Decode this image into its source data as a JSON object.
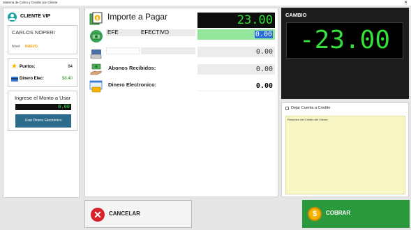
{
  "window": {
    "title": "Sistema de Cobro y Credito por Cliente",
    "close_glyph": "✕"
  },
  "customer": {
    "section_title": "CLIENTE VIP",
    "name": "CARLOS NOPERI",
    "level_label": "Nivel:",
    "level_value": "NUEVO",
    "points_label": "Puntos:",
    "points_value": "84",
    "wallet_label": "Dinero Elec:",
    "wallet_value": "$8.40"
  },
  "wallet_use": {
    "title": "Ingrese el Monto a Usar",
    "amount": "0.00",
    "button_label": "Usar Dinero Electrónico"
  },
  "payment": {
    "total_label": "Importe a Pagar",
    "total_amount": "23.00",
    "method_code": "EFE",
    "method_name": "EFECTIVO",
    "method_amount": "0.00",
    "second_amount": "0.00",
    "abonos_label": "Abonos Recibidos:",
    "abonos_amount": "0.00",
    "electronic_label": "Dinero Electronico:",
    "electronic_amount": "0.00"
  },
  "change": {
    "label": "CAMBIO",
    "amount": "-23.00"
  },
  "credit": {
    "checkbox_label": "Dejar Cuenta a Credito",
    "summary_label": "Resumen del Crédito del Cliente"
  },
  "actions": {
    "cancel_label": "CANCELAR",
    "charge_label": "COBRAR"
  },
  "colors": {
    "accent_green": "#2b9a3c",
    "display_green": "#33e033",
    "cancel_red": "#d6222a",
    "vip_teal": "#1aa3a3"
  },
  "icons": [
    "user-icon",
    "star-icon",
    "card-icon",
    "money-icon",
    "bills-icon",
    "payment-icon",
    "hand-money-icon",
    "web-payment-icon",
    "close-icon",
    "coin-icon"
  ]
}
